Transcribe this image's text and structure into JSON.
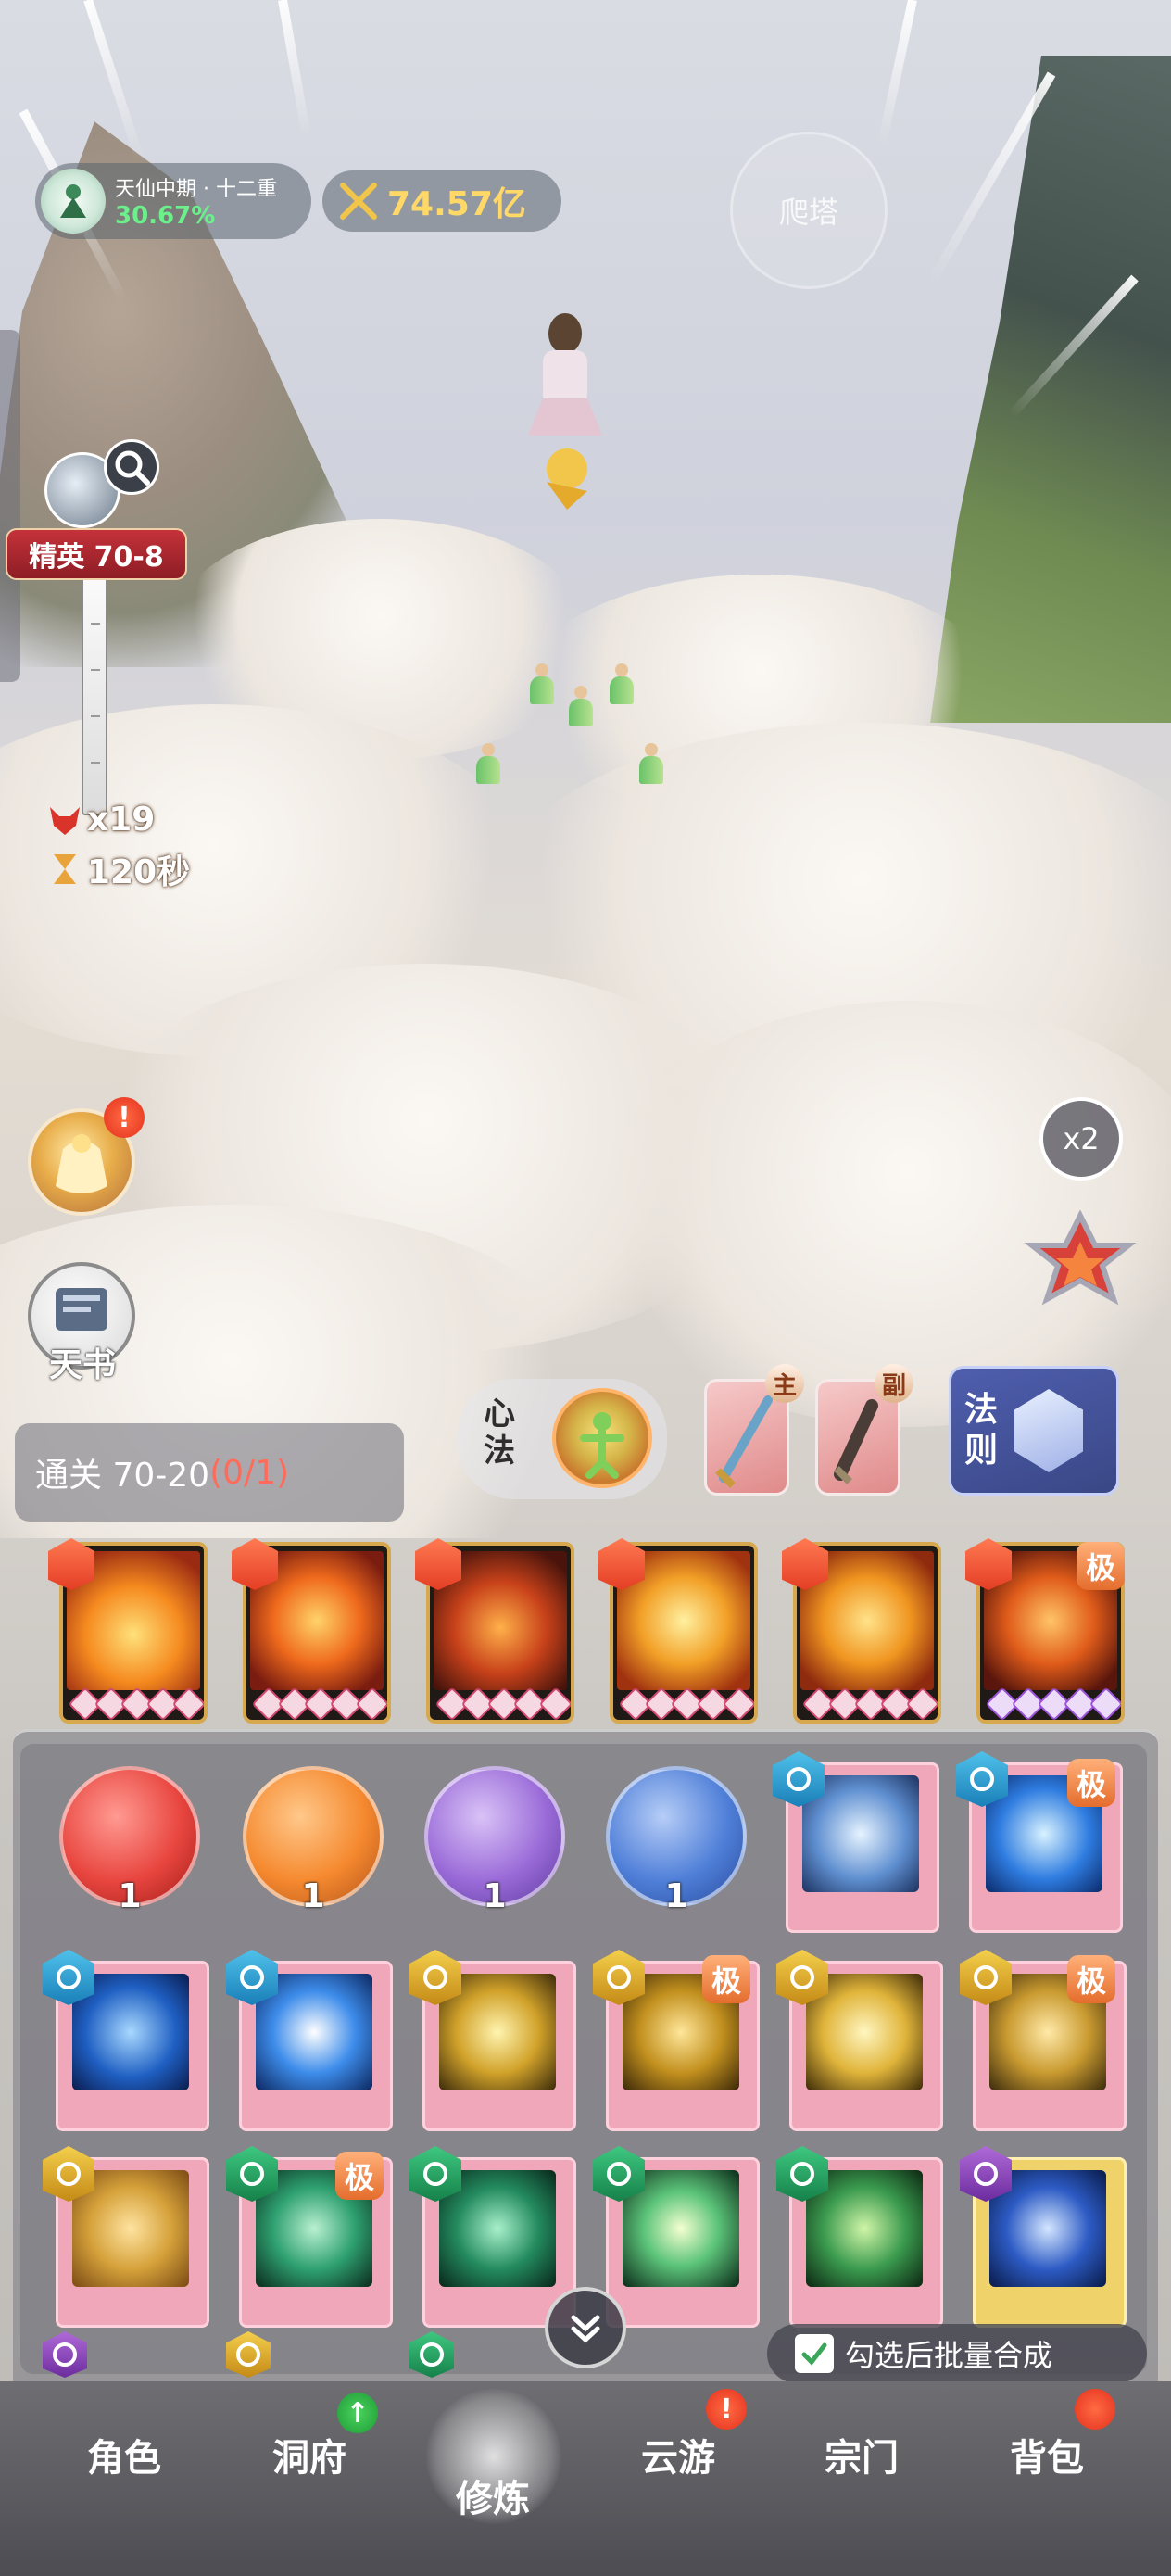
{
  "hud": {
    "realm_name": "天仙中期 · 十二重",
    "realm_progress": "30.67%",
    "combat_power": "74.57亿",
    "tower_label": "爬塔"
  },
  "stage": {
    "label": "精英 70-8",
    "enemy_count": "x19",
    "time_left": "120秒"
  },
  "left_buttons": {
    "bag_alert": "!",
    "book_label": "天书"
  },
  "right_buttons": {
    "speed_label": "x2"
  },
  "clear": {
    "label": "通关 70-20",
    "progress": "(0/1)"
  },
  "method": {
    "label": "心法"
  },
  "weapons": {
    "main_tag": "主",
    "sub_tag": "副"
  },
  "law": {
    "label": "法则"
  },
  "equipped_skills": [
    {
      "name": "fire-lotus",
      "top_tag": ""
    },
    {
      "name": "phoenix",
      "top_tag": ""
    },
    {
      "name": "fire-spirit",
      "top_tag": ""
    },
    {
      "name": "pagoda",
      "top_tag": ""
    },
    {
      "name": "buddha",
      "top_tag": ""
    },
    {
      "name": "flame-dragon",
      "top_tag": "极"
    }
  ],
  "inventory": {
    "orbs": [
      {
        "color": "#e8463f",
        "count": "1"
      },
      {
        "color": "#f5892f",
        "count": "1"
      },
      {
        "color": "#9a6bd8",
        "count": "1"
      },
      {
        "color": "#4f7fd8",
        "count": "1"
      }
    ],
    "tag_ji": "极",
    "batch_label": "勾选后批量合成"
  },
  "nav": {
    "role": "角色",
    "cave": "洞府",
    "train": "修炼",
    "travel": "云游",
    "sect": "宗门",
    "bag": "背包",
    "cave_badge": "↑",
    "travel_alert": "!"
  }
}
